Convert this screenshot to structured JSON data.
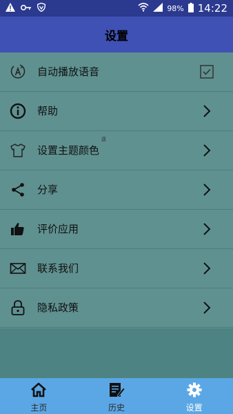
{
  "status_bar": {
    "battery": "98%",
    "time": "14:22",
    "icons": [
      "warning-icon",
      "key-icon",
      "shield-icon",
      "wifi-icon",
      "signal-icon",
      "battery-icon"
    ]
  },
  "app_bar": {
    "title": "设置"
  },
  "settings": [
    {
      "label": "自动播放语音",
      "icon": "auto-play-icon",
      "control": "checkbox",
      "checked": true
    },
    {
      "label": "帮助",
      "icon": "info-icon",
      "control": "chevron"
    },
    {
      "label": "设置主题颜色",
      "icon": "shirt-icon",
      "control": "chevron"
    },
    {
      "label": "分享",
      "icon": "share-icon",
      "control": "chevron"
    },
    {
      "label": "评价应用",
      "icon": "thumbs-up-icon",
      "control": "chevron"
    },
    {
      "label": "联系我们",
      "icon": "mail-icon",
      "control": "chevron"
    },
    {
      "label": "隐私政策",
      "icon": "lock-icon",
      "control": "chevron"
    }
  ],
  "theme_row_mark": "逐",
  "bottom_nav": {
    "tabs": [
      {
        "label": "主页",
        "icon": "home-icon",
        "active": false
      },
      {
        "label": "历史",
        "icon": "history-icon",
        "active": false
      },
      {
        "label": "设置",
        "icon": "gear-icon",
        "active": true
      }
    ]
  },
  "colors": {
    "status_bar": "#2b3a8f",
    "app_bar": "#3f51b5",
    "list_background": "#5f9190",
    "page_background": "#4d8382",
    "bottom_nav": "#5ba7e6",
    "active_tab": "#ffffff"
  }
}
